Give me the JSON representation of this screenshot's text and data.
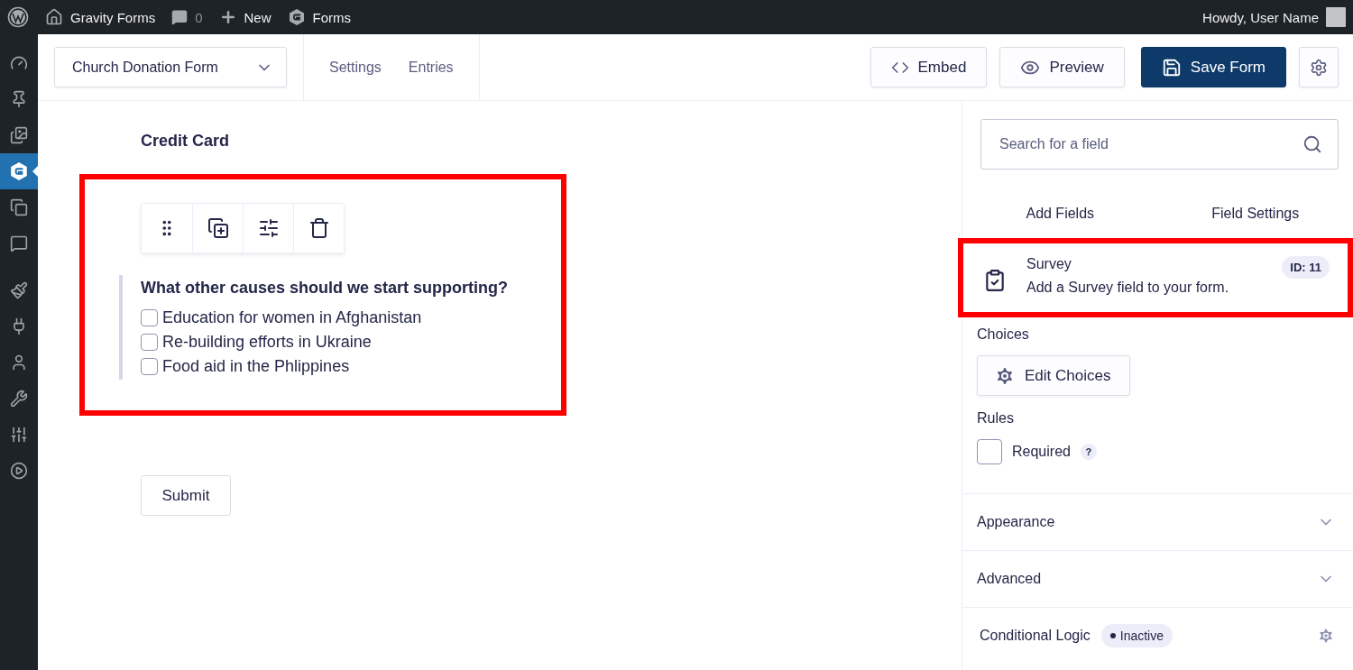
{
  "admin_bar": {
    "site": "Gravity Forms",
    "comments": "0",
    "new": "New",
    "forms": "Forms",
    "greeting": "Howdy, User Name"
  },
  "admin_menu": [
    {
      "selected": false
    },
    {
      "selected": false
    },
    {
      "selected": false
    },
    {
      "selected": true
    },
    {
      "selected": false
    },
    {
      "selected": false
    },
    {
      "selected": false
    },
    {
      "selected": false
    },
    {
      "selected": false
    },
    {
      "selected": false
    },
    {
      "selected": false
    },
    {
      "selected": false
    }
  ],
  "header": {
    "form_select": "Church Donation Form",
    "links": [
      "Settings",
      "Entries"
    ],
    "embed": "Embed",
    "preview": "Preview",
    "save": "Save Form"
  },
  "canvas": {
    "section_title": "Credit Card",
    "field": {
      "label": "What other causes should we start supporting?",
      "choices": [
        {
          "label": "Education for women in Afghanistan",
          "checked": false
        },
        {
          "label": "Re-building efforts in Ukraine",
          "checked": false
        },
        {
          "label": "Food aid in the Phlippines",
          "checked": false
        }
      ]
    },
    "submit": "Submit"
  },
  "panel": {
    "search": {
      "placeholder": "Search for a field"
    },
    "tabs": [
      "Add Fields",
      "Field Settings"
    ],
    "field": {
      "title": "Survey",
      "description": "Add a Survey field to your form.",
      "id": "ID: 11"
    },
    "choices_label": "Choices",
    "edit_choices": "Edit Choices",
    "rules_label": "Rules",
    "required": {
      "label": "Required",
      "help": "?",
      "checked": false
    },
    "sections": [
      {
        "title": "Appearance",
        "expanded": false
      },
      {
        "title": "Advanced",
        "expanded": false
      }
    ],
    "conditional_logic": {
      "title": "Conditional Logic",
      "status": "Inactive"
    }
  }
}
